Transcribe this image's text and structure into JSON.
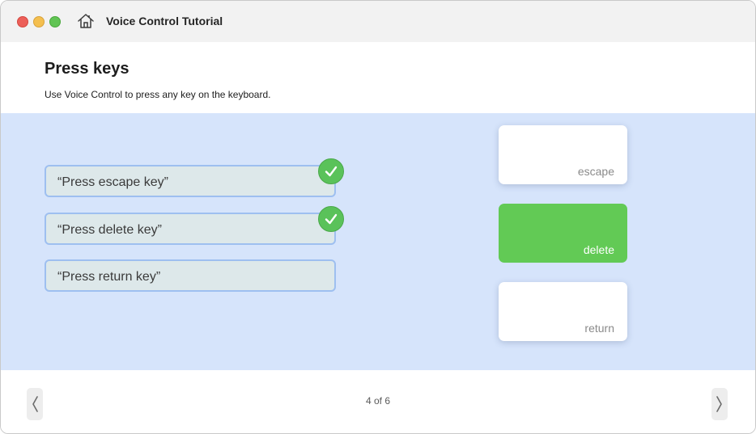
{
  "window": {
    "title": "Voice Control Tutorial",
    "traffic_lights": [
      "#ec5f59",
      "#f4bf4f",
      "#61c454"
    ]
  },
  "header": {
    "title": "Press keys",
    "subtitle": "Use Voice Control to press any key on the keyboard."
  },
  "commands": [
    {
      "text": "“Press escape key”",
      "completed": true
    },
    {
      "text": "“Press delete key”",
      "completed": true
    },
    {
      "text": "“Press return key”",
      "completed": false
    }
  ],
  "keys": [
    {
      "label": "escape",
      "active": false
    },
    {
      "label": "delete",
      "active": true
    },
    {
      "label": "return",
      "active": false
    }
  ],
  "footer": {
    "page_indicator": "4 of 6"
  },
  "colors": {
    "stage_background": "#d6e4fb",
    "active_key": "#62ca55",
    "check": "#5ac25a"
  },
  "icons": {
    "home": "home-icon",
    "check": "checkmark-icon",
    "prev": "chevron-left-icon",
    "next": "chevron-right-icon"
  }
}
